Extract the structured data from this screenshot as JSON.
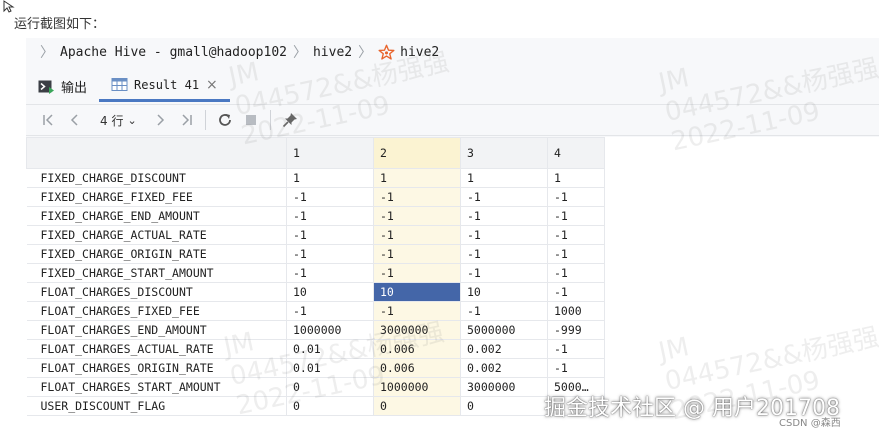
{
  "caption": "运行截图如下：",
  "breadcrumb": {
    "items": [
      "Apache Hive - gmall@hadoop102",
      "hive2",
      "hive2"
    ],
    "star_icon_color": "#e8642c"
  },
  "tabs": [
    {
      "label": "输出",
      "icon": "console-output-icon",
      "active": false
    },
    {
      "label": "Result 41",
      "icon": "table-grid-icon",
      "active": true,
      "close": "×"
    }
  ],
  "toolbar": {
    "rows_label": "4 行",
    "icons": [
      "first-page-icon",
      "prev-page-icon",
      "next-page-icon",
      "last-page-icon",
      "refresh-icon",
      "stop-icon",
      "pin-icon"
    ]
  },
  "grid": {
    "columns": [
      "1",
      "2",
      "3",
      "4"
    ],
    "rows": [
      {
        "label": "FIXED_CHARGE_DISCOUNT",
        "cells": [
          "1",
          "1",
          "1",
          "1"
        ]
      },
      {
        "label": "FIXED_CHARGE_FIXED_FEE",
        "cells": [
          "-1",
          "-1",
          "-1",
          "-1"
        ]
      },
      {
        "label": "FIXED_CHARGE_END_AMOUNT",
        "cells": [
          "-1",
          "-1",
          "-1",
          "-1"
        ]
      },
      {
        "label": "FIXED_CHARGE_ACTUAL_RATE",
        "cells": [
          "-1",
          "-1",
          "-1",
          "-1"
        ]
      },
      {
        "label": "FIXED_CHARGE_ORIGIN_RATE",
        "cells": [
          "-1",
          "-1",
          "-1",
          "-1"
        ]
      },
      {
        "label": "FIXED_CHARGE_START_AMOUNT",
        "cells": [
          "-1",
          "-1",
          "-1",
          "-1"
        ]
      },
      {
        "label": "FLOAT_CHARGES_DISCOUNT",
        "cells": [
          "10",
          "10",
          "10",
          "-1"
        ]
      },
      {
        "label": "FLOAT_CHARGES_FIXED_FEE",
        "cells": [
          "-1",
          "-1",
          "-1",
          "1000"
        ]
      },
      {
        "label": "FLOAT_CHARGES_END_AMOUNT",
        "cells": [
          "1000000",
          "3000000",
          "5000000",
          "-999"
        ]
      },
      {
        "label": "FLOAT_CHARGES_ACTUAL_RATE",
        "cells": [
          "0.01",
          "0.006",
          "0.002",
          "-1"
        ]
      },
      {
        "label": "FLOAT_CHARGES_ORIGIN_RATE",
        "cells": [
          "0.01",
          "0.006",
          "0.002",
          "-1"
        ]
      },
      {
        "label": "FLOAT_CHARGES_START_AMOUNT",
        "cells": [
          "0",
          "1000000",
          "3000000",
          "5000…"
        ]
      },
      {
        "label": "USER_DISCOUNT_FLAG",
        "cells": [
          "0",
          "0",
          "0",
          ""
        ]
      }
    ],
    "selected_cell": {
      "row": 6,
      "col": 1
    },
    "highlight_column": 1,
    "colors": {
      "selected": "#4466a8",
      "highlight_col": "#fdf8e4"
    }
  },
  "watermark": {
    "lines": [
      "JM",
      "044572&&杨强强",
      "2022-11-09"
    ]
  },
  "footer": {
    "brand": "掘金技术社区 @ 用户201708",
    "csdn": "CSDN @森西"
  }
}
